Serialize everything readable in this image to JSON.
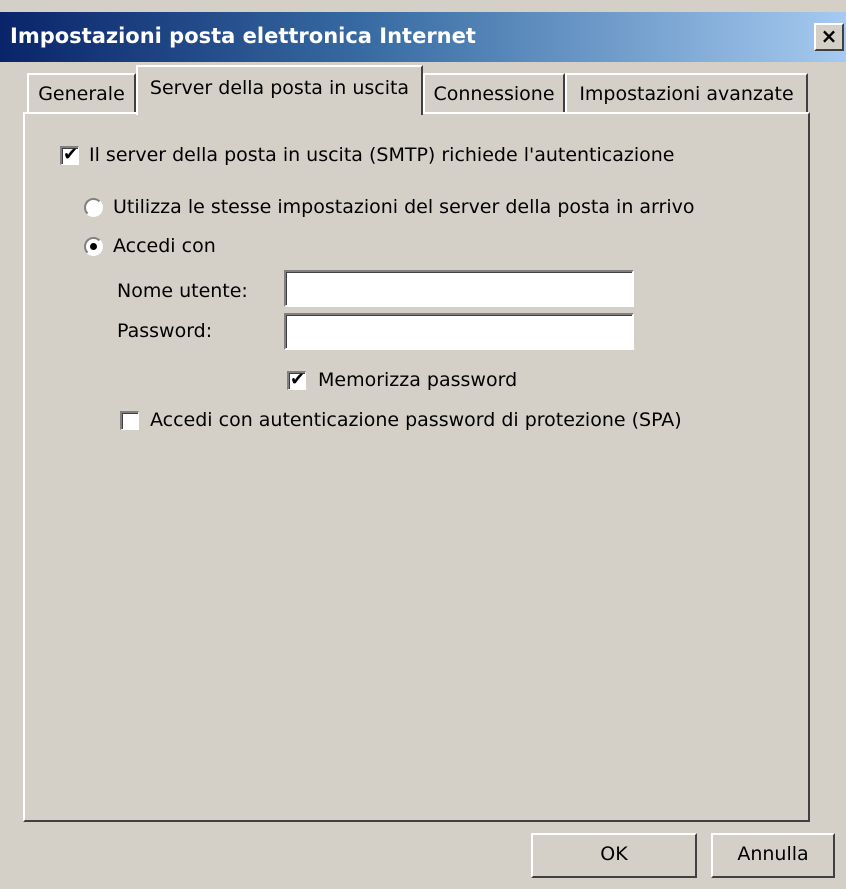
{
  "window": {
    "title": "Impostazioni posta elettronica Internet",
    "close_label": "×"
  },
  "tabs": [
    {
      "label": "Generale",
      "active": false
    },
    {
      "label": "Server della posta in uscita",
      "active": true
    },
    {
      "label": "Connessione",
      "active": false
    },
    {
      "label": "Impostazioni avanzate",
      "active": false
    }
  ],
  "panel": {
    "smtp_auth": {
      "label": "Il server della posta in uscita (SMTP) richiede l'autenticazione",
      "checked": true
    },
    "use_same_settings": {
      "label": "Utilizza le stesse impostazioni del server della posta in arrivo",
      "selected": false
    },
    "login_with": {
      "label": "Accedi con",
      "selected": true
    },
    "username": {
      "label": "Nome utente:",
      "value": ""
    },
    "password": {
      "label": "Password:",
      "value": ""
    },
    "remember_password": {
      "label": "Memorizza password",
      "checked": true
    },
    "spa": {
      "label": "Accedi con autenticazione password di protezione (SPA)",
      "checked": false
    }
  },
  "buttons": {
    "ok": "OK",
    "cancel": "Annulla"
  },
  "marks": {
    "check": "✔"
  }
}
